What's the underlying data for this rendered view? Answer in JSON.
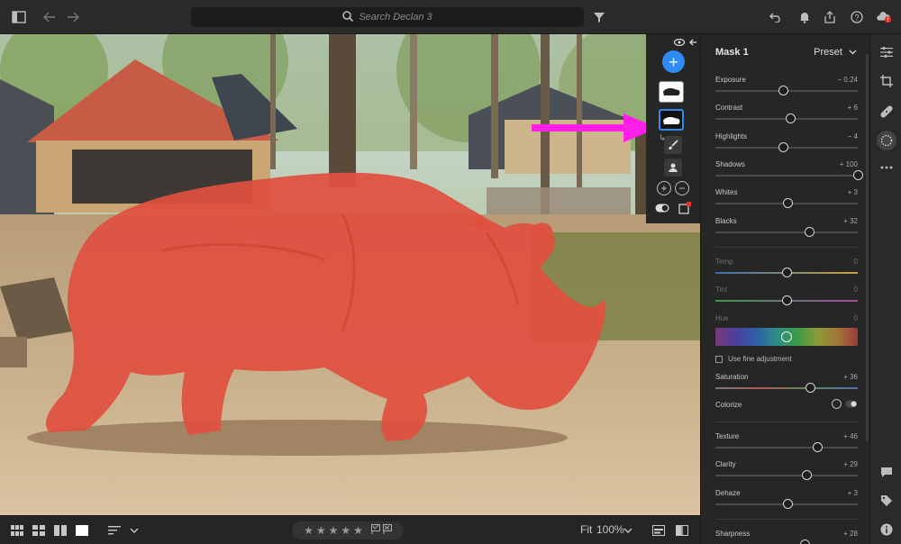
{
  "topbar": {
    "search_placeholder": "Search Declan 3"
  },
  "mask_panel": {
    "add_label": "+"
  },
  "bottombar": {
    "stars": [
      "★",
      "★",
      "★",
      "★",
      "★"
    ],
    "zoom_fit": "Fit",
    "zoom_level": "100%"
  },
  "panel": {
    "title": "Mask 1",
    "preset": "Preset",
    "light_sliders": [
      {
        "label": "Exposure",
        "value": "− 0.24",
        "pos": 0.48
      },
      {
        "label": "Contrast",
        "value": "+ 6",
        "pos": 0.53
      },
      {
        "label": "Highlights",
        "value": "− 4",
        "pos": 0.48
      },
      {
        "label": "Shadows",
        "value": "+ 100",
        "pos": 1.0
      },
      {
        "label": "Whites",
        "value": "+ 3",
        "pos": 0.51
      },
      {
        "label": "Blacks",
        "value": "+ 32",
        "pos": 0.66
      }
    ],
    "color_sliders": [
      {
        "label": "Temp",
        "value": "0",
        "pos": 0.5
      },
      {
        "label": "Tint",
        "value": "0",
        "pos": 0.5
      },
      {
        "label": "Hue",
        "value": "0",
        "pos": 0.5
      }
    ],
    "fine_adjustment": "Use fine adjustment",
    "saturation": {
      "label": "Saturation",
      "value": "+ 36",
      "pos": 0.67
    },
    "colorize": "Colorize",
    "effects_sliders": [
      {
        "label": "Texture",
        "value": "+ 46",
        "pos": 0.72
      },
      {
        "label": "Clarity",
        "value": "+ 29",
        "pos": 0.64
      },
      {
        "label": "Dehaze",
        "value": "+ 3",
        "pos": 0.51
      }
    ],
    "detail_sliders": [
      {
        "label": "Sharpness",
        "value": "+ 28",
        "pos": 0.63
      }
    ]
  },
  "colors": {
    "accent": "#2f8bf2",
    "mask_overlay": "#e0503f",
    "arrow": "#ff1ee8"
  }
}
